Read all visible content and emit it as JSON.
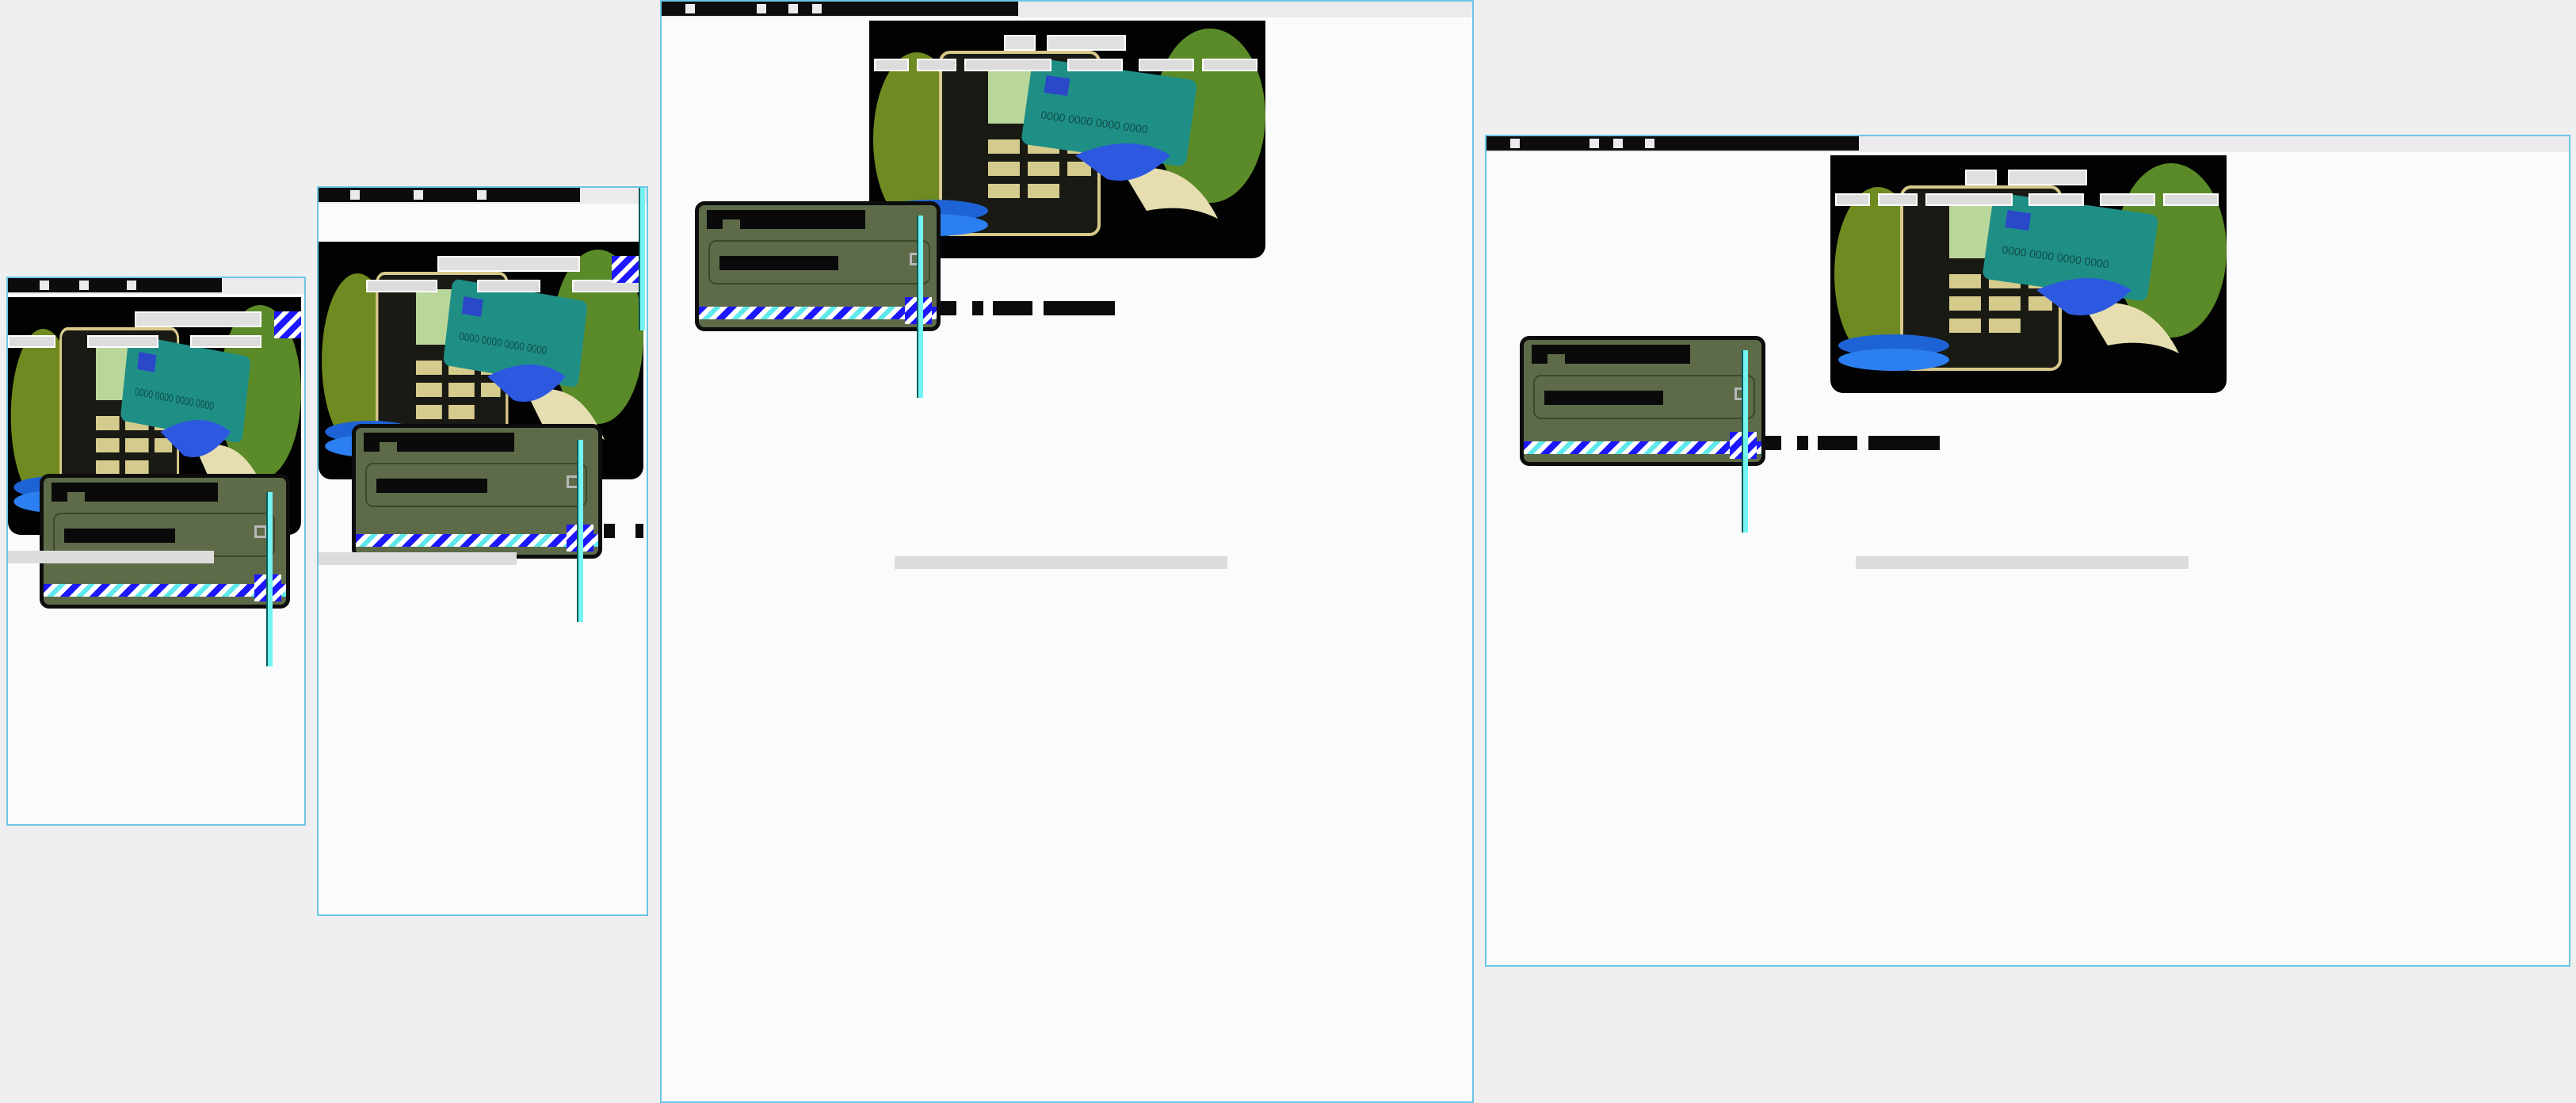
{
  "screen": {
    "background": "#efefef"
  },
  "colors": {
    "frame_border": "#6cc6e6",
    "frame_fill": "#fafbfc",
    "card_fill": "#5e6b49",
    "card_border": "#0d0d0d",
    "stripe_blue": "#1d17ff",
    "stripe_cyan": "#5ee8ea",
    "art_background": "#020202",
    "credit_card": "#1f8f86",
    "coins": "#1e63d6"
  },
  "art": {
    "credit_card_number": "0000 0000 0000 0000",
    "credit_card_contactless_icon": "contactless-icon",
    "leaf_icon": "leaf-icon",
    "coins_icon": "coins-icon"
  },
  "preview_panes": [
    {
      "name": "mobile-small",
      "caption": "",
      "loading_text": ""
    },
    {
      "name": "mobile-large",
      "caption": "",
      "loading_text": ""
    },
    {
      "name": "tablet",
      "caption": "",
      "loading_text": ""
    },
    {
      "name": "desktop",
      "caption": "",
      "loading_text": ""
    }
  ]
}
